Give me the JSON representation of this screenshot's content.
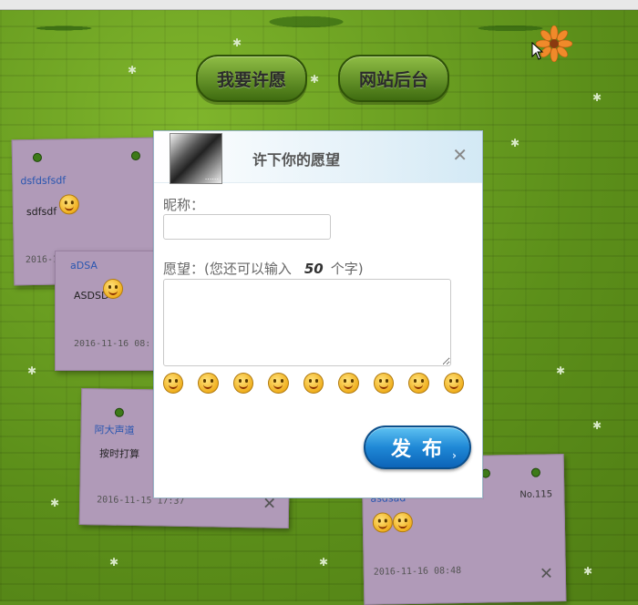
{
  "nav": {
    "make_wish_label": "我要许愿",
    "admin_label": "网站后台"
  },
  "notes": [
    {
      "name": "dsfdsfsdf",
      "message": "sdfsdf",
      "date": "2016-11-"
    },
    {
      "name": "aDSA",
      "message": "ASDSD",
      "date": "2016-11-16 08:"
    },
    {
      "name": "阿大声道",
      "message": "按时打算",
      "date": "2016-11-15 17:37",
      "close": "✕"
    },
    {
      "name": "asdsad",
      "message": "",
      "date": "2016-11-16 08:48",
      "number": "No.115",
      "close": "✕"
    }
  ],
  "dialog": {
    "title": "许下你的愿望",
    "close": "✕",
    "nickname_label": "昵称：",
    "nickname_value": "",
    "wish_label_prefix": "愿望：(您还可以输入",
    "wish_remaining": "50",
    "wish_label_suffix": "个字)",
    "wish_value": "",
    "emoticons": [
      "grin-squint-icon",
      "shy-blush-icon",
      "smile-icon",
      "cool-sunglasses-icon",
      "big-grin-icon",
      "hug-icon",
      "shush-icon",
      "heart-eyes-icon",
      "wink-tongue-icon"
    ],
    "publish_label": "发布"
  },
  "colors": {
    "background": "#5e8f1e",
    "note": "#b09ab8",
    "publish": "#1f88d6",
    "link": "#2a56b0"
  }
}
